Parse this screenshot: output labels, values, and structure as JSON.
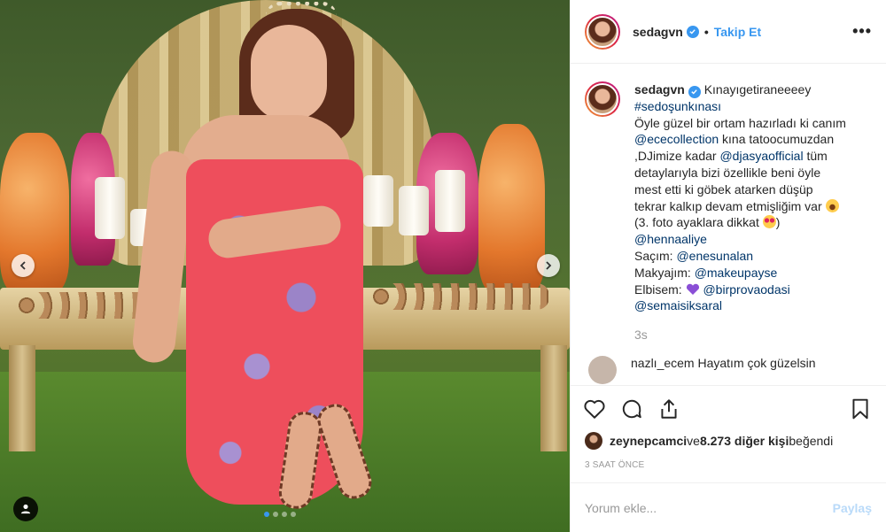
{
  "header": {
    "username": "sedagvn",
    "separator": "•",
    "follow_label": "Takip Et",
    "more_label": "•••"
  },
  "caption": {
    "username": "sedagvn",
    "lines": {
      "l1": "Kınayıgetiraneeeey",
      "l2_tag": "#sedoşunkınası",
      "l3": "Öyle güzel bir ortam hazırladı ki canım",
      "l4_mention": "@ececollection",
      "l4_text": " kına tatoocumuzdan",
      "l5_text": ",DJimize kadar ",
      "l5_mention": "@djasyaofficial",
      "l5_text2": " tüm",
      "l6": "detaylarıyla bizi özellikle beni öyle",
      "l7": "mest etti ki göbek atarken düşüp",
      "l8": "tekrar kalkıp devam etmişliğim var ",
      "l9": "(3. foto ayaklara dikkat ",
      "l9_end": ")",
      "l10_mention": "@hennaaliye",
      "l11_label": "Saçım: ",
      "l11_mention": "@enesunalan",
      "l12_label": "Makyajım: ",
      "l12_mention": "@makeupayse",
      "l13_label": "Elbisem: ",
      "l13_mention": "@birprovaodasi",
      "l14_mention": "@semaisiksaral"
    },
    "age": "3s"
  },
  "reply_preview": "nazlı_ecem  Hayatım çok güzelsin",
  "likes": {
    "user": "zeynepcamci",
    "middle": " ve ",
    "count_text": "8.273 diğer kişi",
    "suffix": " beğendi"
  },
  "posted_time": "3 SAAT ÖNCE",
  "comment_box": {
    "placeholder": "Yorum ekle...",
    "post_label": "Paylaş"
  },
  "carousel": {
    "total": 4,
    "active_index": 0
  },
  "colors": {
    "accent": "#3897f0",
    "mention": "#003569",
    "muted": "#999999"
  },
  "icons": [
    "chevron-left-icon",
    "chevron-right-icon",
    "user-tag-icon",
    "heart-icon",
    "comment-icon",
    "share-icon",
    "bookmark-icon",
    "verified-badge-icon",
    "ellipsis-icon"
  ]
}
